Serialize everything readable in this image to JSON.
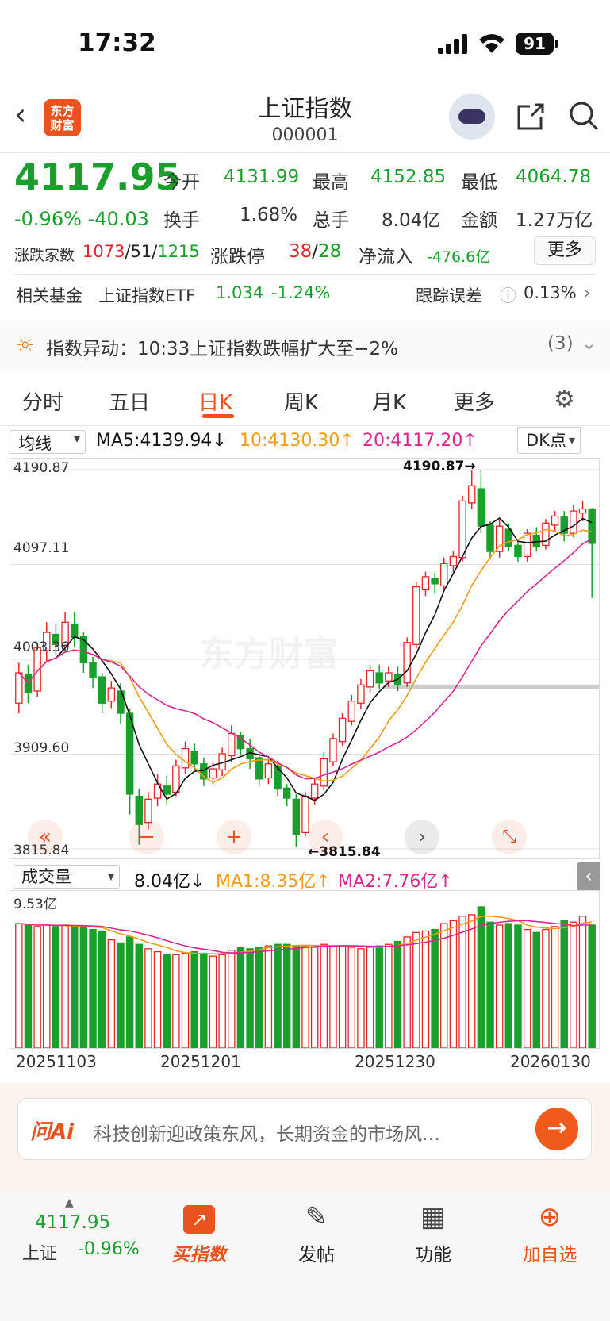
{
  "status": {
    "time": "17:32",
    "battery": "91"
  },
  "header": {
    "title": "上证指数",
    "code": "000001",
    "logo": "东方财富"
  },
  "quote": {
    "price": "4117.95",
    "pct": "-0.96%",
    "change": "-40.03",
    "open_label": "今开",
    "open": "4131.99",
    "high_label": "最高",
    "high": "4152.85",
    "low_label": "最低",
    "low": "4064.78",
    "turnover_label": "换手",
    "turnover": "1.68%",
    "volume_label": "总手",
    "volume": "8.04亿",
    "amount_label": "金额",
    "amount": "1.27万亿",
    "breadth_label": "涨跌家数",
    "up_count": "1073",
    "flat_count": "51",
    "down_count": "1215",
    "limit_label": "涨跌停",
    "limit_up": "38",
    "limit_down": "28",
    "netflow_label": "净流入",
    "netflow": "-476.6亿",
    "more": "更多"
  },
  "fund": {
    "label": "相关基金",
    "name": "上证指数ETF",
    "price": "1.034",
    "pct": "-1.24%",
    "track_label": "跟踪误差",
    "track": "0.13%"
  },
  "alert": {
    "text": "指数异动：10:33上证指数跌幅扩大至−2%",
    "count": "(3)"
  },
  "tabs": [
    "分时",
    "五日",
    "日K",
    "周K",
    "月K",
    "更多"
  ],
  "ma_bar": {
    "select": "均线",
    "ma5": "MA5:4139.94↓",
    "ma10": "10:4130.30↑",
    "ma20": "20:4117.20↑",
    "dk": "DK点"
  },
  "chart_labels": {
    "p1": "4190.87",
    "p2": "4097.11",
    "p3": "4003.36",
    "p4": "3909.60",
    "p5": "3815.84",
    "high_mark": "4190.87→",
    "low_mark": "←3815.84",
    "watermark": "东方财富"
  },
  "vol_bar": {
    "select": "成交量",
    "vol": "8.04亿↓",
    "ma1": "MA1:8.35亿↑",
    "ma2": "MA2:7.76亿↑",
    "max": "9.53亿"
  },
  "dates": [
    "20251103",
    "20251201",
    "20251230",
    "20260130"
  ],
  "ai": {
    "word": "问Ai",
    "text": "科技创新迎政策东风，长期资金的市场风…"
  },
  "nav": {
    "price": "4117.95",
    "name": "上证",
    "pct": "-0.96%",
    "buy": "买指数",
    "post": "发帖",
    "func": "功能",
    "add": "加自选"
  },
  "colors": {
    "up": "#e4252c",
    "down": "#1a9e2c",
    "ma5": "#111111",
    "ma10": "#f39c12",
    "ma20": "#d6288f",
    "accent": "#e8531f"
  },
  "chart_data": {
    "type": "candlestick",
    "ylim": [
      3815.84,
      4190.87
    ],
    "y_ticks": [
      "4190.87",
      "4097.11",
      "4003.36",
      "3909.60",
      "3815.84"
    ],
    "candles": [
      [
        3960,
        3990,
        3950,
        4000
      ],
      [
        3988,
        3970,
        3960,
        3998
      ],
      [
        3972,
        4015,
        3966,
        4020
      ],
      [
        4012,
        4030,
        4000,
        4040
      ],
      [
        4028,
        4018,
        4008,
        4038
      ],
      [
        4016,
        4040,
        4010,
        4050
      ],
      [
        4038,
        4025,
        4015,
        4050
      ],
      [
        4026,
        4000,
        3990,
        4030
      ],
      [
        4000,
        3985,
        3975,
        4006
      ],
      [
        3986,
        3960,
        3950,
        3990
      ],
      [
        3962,
        3975,
        3955,
        3982
      ],
      [
        3972,
        3950,
        3940,
        3980
      ],
      [
        3950,
        3870,
        3850,
        3955
      ],
      [
        3868,
        3840,
        3820,
        3875
      ],
      [
        3842,
        3865,
        3835,
        3872
      ],
      [
        3866,
        3880,
        3858,
        3890
      ],
      [
        3878,
        3870,
        3860,
        3888
      ],
      [
        3872,
        3898,
        3868,
        3904
      ],
      [
        3896,
        3915,
        3890,
        3922
      ],
      [
        3912,
        3900,
        3894,
        3920
      ],
      [
        3900,
        3885,
        3878,
        3906
      ],
      [
        3886,
        3895,
        3880,
        3902
      ],
      [
        3894,
        3910,
        3888,
        3916
      ],
      [
        3908,
        3930,
        3902,
        3938
      ],
      [
        3928,
        3915,
        3908,
        3932
      ],
      [
        3915,
        3905,
        3895,
        3925
      ],
      [
        3906,
        3885,
        3878,
        3910
      ],
      [
        3886,
        3900,
        3880,
        3905
      ],
      [
        3898,
        3875,
        3868,
        3903
      ],
      [
        3876,
        3866,
        3858,
        3880
      ],
      [
        3865,
        3830,
        3818,
        3870
      ],
      [
        3832,
        3868,
        3828,
        3872
      ],
      [
        3866,
        3880,
        3860,
        3886
      ],
      [
        3878,
        3905,
        3874,
        3912
      ],
      [
        3902,
        3925,
        3898,
        3930
      ],
      [
        3922,
        3945,
        3918,
        3950
      ],
      [
        3942,
        3962,
        3938,
        3968
      ],
      [
        3960,
        3978,
        3954,
        3984
      ],
      [
        3976,
        3992,
        3970,
        3998
      ],
      [
        3990,
        3980,
        3974,
        3998
      ],
      [
        3982,
        3990,
        3976,
        3996
      ],
      [
        3988,
        3978,
        3972,
        3996
      ],
      [
        3980,
        4020,
        3976,
        4025
      ],
      [
        4018,
        4075,
        4014,
        4080
      ],
      [
        4072,
        4085,
        4066,
        4090
      ],
      [
        4083,
        4078,
        4068,
        4088
      ],
      [
        4076,
        4098,
        4072,
        4104
      ],
      [
        4096,
        4105,
        4090,
        4110
      ],
      [
        4104,
        4160,
        4100,
        4165
      ],
      [
        4158,
        4175,
        4152,
        4190
      ],
      [
        4172,
        4135,
        4128,
        4190
      ],
      [
        4136,
        4110,
        4102,
        4140
      ],
      [
        4110,
        4135,
        4104,
        4142
      ],
      [
        4132,
        4115,
        4110,
        4138
      ],
      [
        4116,
        4105,
        4100,
        4120
      ],
      [
        4105,
        4128,
        4100,
        4132
      ],
      [
        4126,
        4115,
        4110,
        4134
      ],
      [
        4116,
        4138,
        4112,
        4142
      ],
      [
        4136,
        4145,
        4130,
        4150
      ],
      [
        4144,
        4128,
        4120,
        4150
      ],
      [
        4128,
        4150,
        4124,
        4156
      ],
      [
        4148,
        4152,
        4140,
        4160
      ],
      [
        4152,
        4118,
        4064,
        4153
      ]
    ],
    "volumes": [
      8.4,
      8.3,
      8.2,
      8.3,
      8.2,
      8.3,
      8.2,
      8.2,
      8.0,
      7.9,
      7.3,
      7.1,
      7.5,
      7.0,
      6.7,
      6.5,
      6.3,
      6.3,
      6.4,
      6.5,
      6.4,
      6.2,
      6.3,
      6.6,
      6.8,
      6.7,
      6.8,
      6.9,
      7.0,
      7.0,
      6.9,
      6.9,
      6.8,
      7.0,
      6.9,
      6.9,
      6.8,
      6.7,
      6.8,
      6.9,
      7.0,
      7.2,
      7.5,
      7.8,
      7.9,
      8.0,
      8.4,
      8.6,
      8.9,
      9.0,
      9.53,
      8.5,
      8.3,
      8.4,
      8.3,
      8.0,
      7.8,
      8.0,
      8.2,
      8.6,
      8.5,
      8.9,
      8.3
    ]
  }
}
